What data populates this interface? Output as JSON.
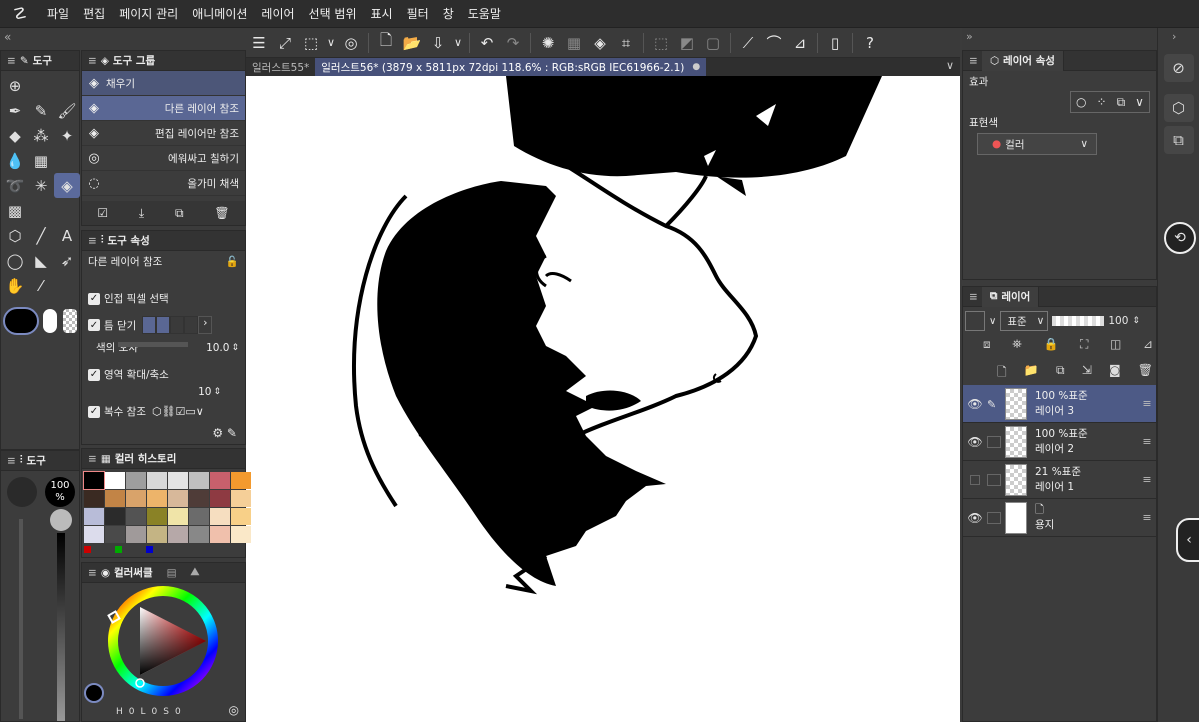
{
  "menu": {
    "logo": "☡",
    "items": [
      "파일",
      "편집",
      "페이지 관리",
      "애니메이션",
      "레이어",
      "선택 범위",
      "표시",
      "필터",
      "창",
      "도움말"
    ]
  },
  "tabs": [
    {
      "label": "일러스트55*"
    },
    {
      "label": "일러스트56* (3879 x 5811px 72dpi 118.6% : RGB:sRGB IEC61966-2.1)",
      "dot": "●"
    }
  ],
  "tools_panel": {
    "title": "도구"
  },
  "group_panel": {
    "title": "도구 그룹",
    "items": [
      "채우기",
      "다른 레이어 참조",
      "편집 레이어만 참조",
      "에워싸고 칠하기",
      "올가미 채색"
    ]
  },
  "prop_panel": {
    "title": "도구 속성",
    "tool_name": "다른 레이어 참조",
    "adjacent": "인접 픽셀 선택",
    "gap_close": "틈 닫기",
    "tolerance_label": "색의 오차",
    "tolerance_value": "10.0",
    "expand_label": "영역 확대/축소",
    "expand_value": "10",
    "multi_ref": "복수 참조"
  },
  "brush_panel": {
    "title": "도구",
    "opacity": "100\n%"
  },
  "history_panel": {
    "title": "컬러 히스토리"
  },
  "wheel_panel": {
    "title": "컬러써클",
    "hsv": {
      "h": "H",
      "h_val": "0",
      "l": "L",
      "l_val": "0",
      "s": "S",
      "s_val": "0"
    }
  },
  "swatches": [
    "#000000",
    "#ffffff",
    "#9e9e9e",
    "#d8d8d8",
    "#e4e4e4",
    "#c0c0c0",
    "#c8606c",
    "#f39a2e",
    "#3a2a22",
    "#c28446",
    "#d9a36a",
    "#edb46a",
    "#d7b89a",
    "#4f3c38",
    "#8e3a42",
    "#f5cf98",
    "#b8bcd8",
    "#2b2b2b",
    "#535353",
    "#8a8226",
    "#f0e4a8",
    "#6b6b6b",
    "#f6dec0",
    "#f8d088",
    "#dcdcec",
    "#4a4a4a",
    "#a09a9a",
    "#c4b484",
    "#b6a8a8",
    "#888888",
    "#f0c0ac",
    "#fae8c8"
  ],
  "right_top": {
    "title": "레이어 속성",
    "effect": "효과",
    "expression": "표현색",
    "color_btn": "컬러"
  },
  "layer_panel": {
    "title": "레이어",
    "blend": "표준",
    "opacity": "100",
    "layers": [
      {
        "line1": "100 %표준",
        "line2": "레이어 3",
        "selected": true
      },
      {
        "line1": "100 %표준",
        "line2": "레이어 2"
      },
      {
        "line1": "21 %표준",
        "line2": "레이어 1"
      },
      {
        "line1": "",
        "line2": "용지"
      }
    ]
  }
}
